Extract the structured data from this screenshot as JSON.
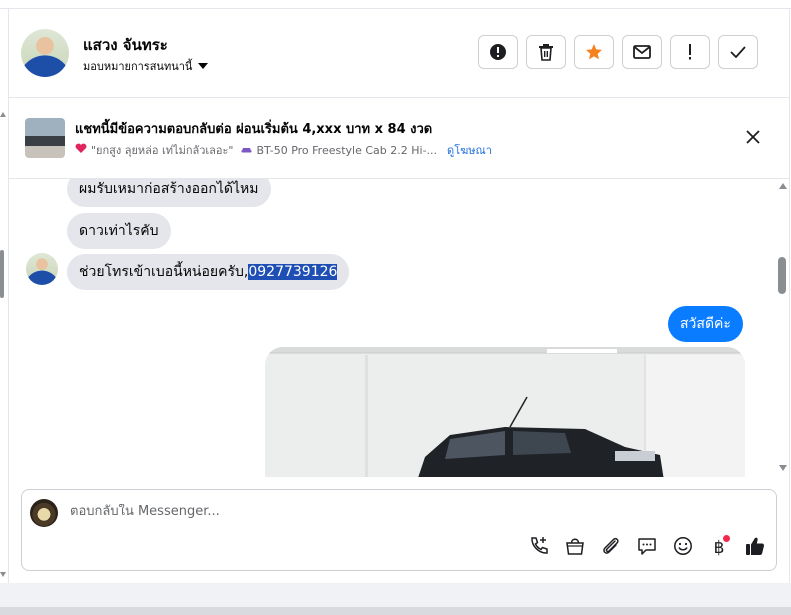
{
  "header": {
    "contact_name": "แสวง จันทระ",
    "assign_label": "มอบหมายการสนทนานี้",
    "actions": [
      {
        "name": "report-button",
        "icon": "alert-circle-icon"
      },
      {
        "name": "delete-button",
        "icon": "trash-icon"
      },
      {
        "name": "star-button",
        "icon": "star-icon"
      },
      {
        "name": "mark-unread-button",
        "icon": "envelope-icon"
      },
      {
        "name": "spam-button",
        "icon": "exclamation-icon"
      },
      {
        "name": "done-button",
        "icon": "check-icon"
      }
    ]
  },
  "ad": {
    "title": "แชทนี้มีข้อความตอบกลับต่อ ผ่อนเริ่มต้น 4,xxx บาท x 84 งวด",
    "subtitle": "\"ยกสูง ลุยหล่อ เท่ไม่กลัวเลอะ\"",
    "model": "BT-50 Pro Freestyle Cab 2.2 Hi-...",
    "link": "ดูโฆษณา"
  },
  "messages": {
    "in_1": "ผมรับเหมาก่อสร้างออกได้ไหม",
    "in_2": "ดาวเท่าไรคับ",
    "in_3_text": "ช่วยโทรเข้าเบอนี้หน่อยครับ,",
    "in_3_number": "0927739126",
    "out_1": "สวัสดีค่ะ"
  },
  "composer": {
    "placeholder": "ตอบกลับใน Messenger...",
    "tools": [
      "call-add-icon",
      "shopping-bag-icon",
      "paperclip-icon",
      "chat-bubble-icon",
      "emoji-icon",
      "baht-icon",
      "thumbs-up-icon"
    ],
    "baht_symbol": "฿"
  },
  "colors": {
    "accent": "#0a7cff",
    "star": "#f58220",
    "incoming_bubble": "#e4e6eb",
    "link": "#216fdb"
  }
}
